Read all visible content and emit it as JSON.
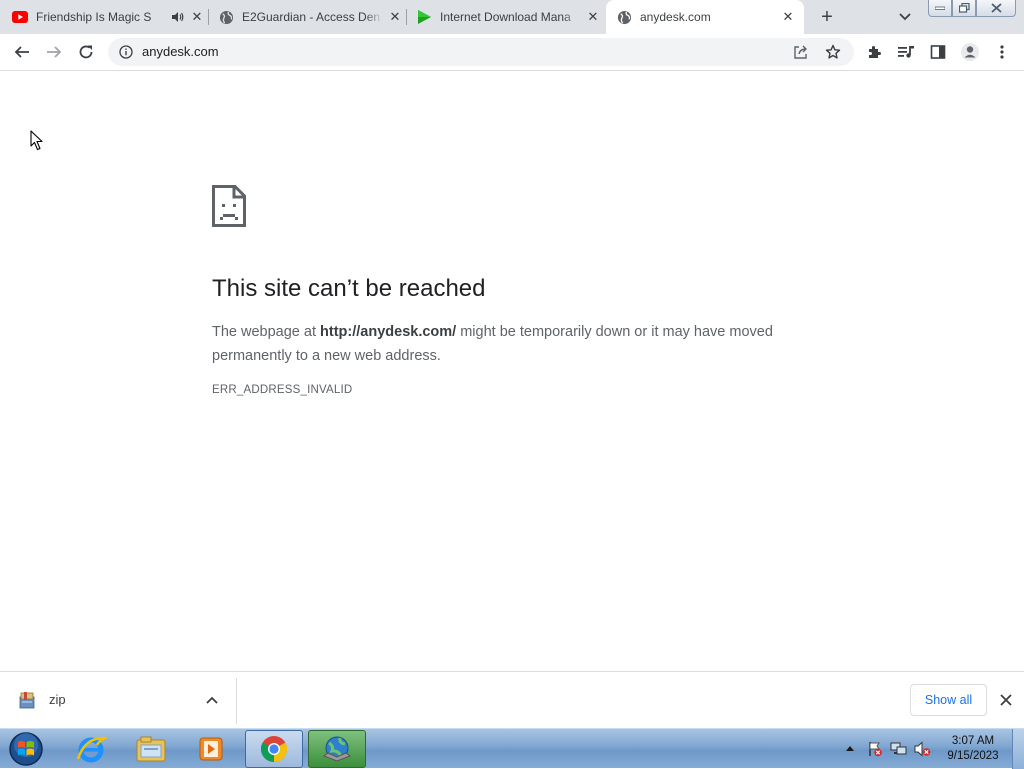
{
  "tabs": [
    {
      "title": "Friendship Is Magic S",
      "favicon": "youtube-icon",
      "audio": true,
      "active": false
    },
    {
      "title": "E2Guardian - Access Den",
      "favicon": "globe-icon",
      "audio": false,
      "active": false
    },
    {
      "title": "Internet Download Mana",
      "favicon": "idm-play-icon",
      "audio": false,
      "active": false
    },
    {
      "title": "anydesk.com",
      "favicon": "globe-icon",
      "audio": false,
      "active": true
    }
  ],
  "toolbar": {
    "url": "anydesk.com"
  },
  "error_page": {
    "heading": "This site can’t be reached",
    "desc_prefix": "The webpage at ",
    "desc_url": "http://anydesk.com/",
    "desc_suffix": " might be temporarily down or it may have moved permanently to a new web address.",
    "error_code": "ERR_ADDRESS_INVALID"
  },
  "download_bar": {
    "file_name": "zip",
    "show_all_label": "Show all"
  },
  "taskbar": {
    "time": "3:07 AM",
    "date": "9/15/2023"
  },
  "colors": {
    "accent": "#1a73e8",
    "tab_strip": "#dee1e6",
    "youtube_red": "#ff0000",
    "idm_green": "#1ea11e"
  }
}
